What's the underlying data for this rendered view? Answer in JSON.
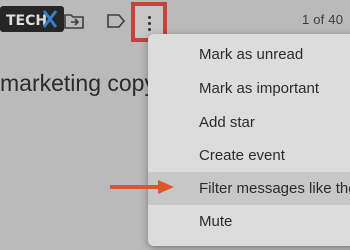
{
  "toolbar": {
    "logo_text": "TECH-X",
    "icons": [
      "tech-x-logo",
      "move-to-icon",
      "label-icon",
      "more-vert-icon"
    ],
    "pager": "1 of 40"
  },
  "email": {
    "subject": "marketing copy"
  },
  "menu": {
    "items": [
      {
        "label": "Mark as unread"
      },
      {
        "label": "Mark as important"
      },
      {
        "label": "Add star"
      },
      {
        "label": "Create event"
      },
      {
        "label": "Filter messages like the"
      },
      {
        "label": "Mute"
      }
    ],
    "highlighted_item": "Filter messages like the"
  },
  "colors": {
    "annotation_red": "#d9463b",
    "arrow_orange": "#e0552d",
    "menu_bg": "#dcdcdc",
    "menu_highlight": "#c7c7c7"
  }
}
